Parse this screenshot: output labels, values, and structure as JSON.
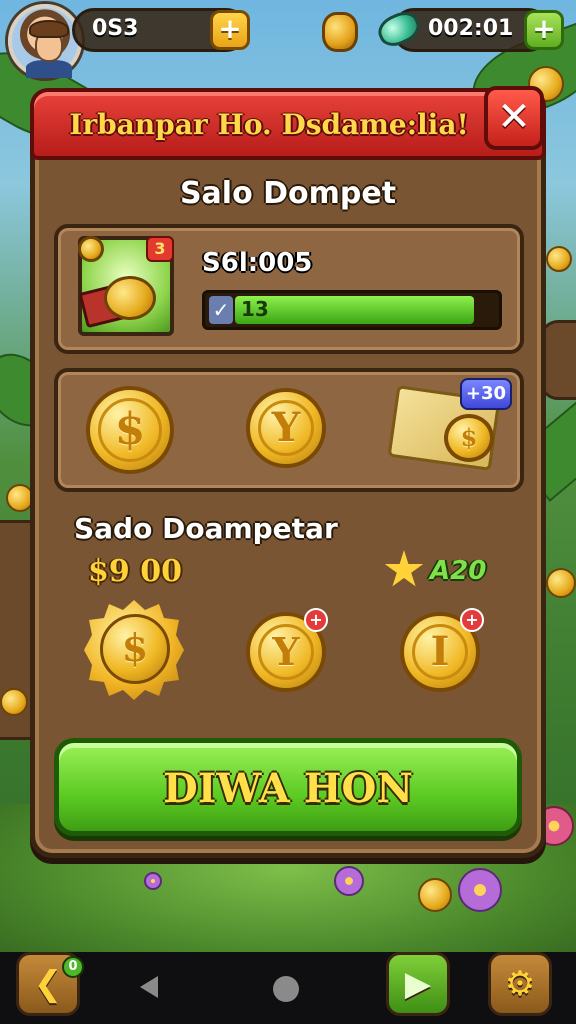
{
  "hud": {
    "coins": "0S3",
    "gems": "002:01",
    "plus_label": "+"
  },
  "dialog": {
    "banner_title": "Irbanpar Ho. Dsdame:lia!",
    "close_label": "✕",
    "wallet_heading": "Salo Dompet",
    "wallet_badge": "3",
    "balance_value": "S6l:005",
    "progress_value": "13",
    "progress_fraction": 0.92,
    "offers_chat_badge": "+30",
    "coin_glyph_dollar": "$",
    "coin_glyph_y": "Y",
    "coin_glyph_bar": "I",
    "section_heading": "Sado Doampetar",
    "gold_amount": "$9 00",
    "green_amount": "A20",
    "plus_badge": "+",
    "action_button": "DIWA HON"
  },
  "nav": {
    "back_glyph": "❮",
    "notif_count": "0",
    "play_glyph": "▶",
    "gear_glyph": "⚙"
  },
  "colors": {
    "banner_red": "#d32f2a",
    "panel_brown": "#7a5534",
    "button_green": "#5ccb22",
    "gold": "#ffd23a"
  }
}
